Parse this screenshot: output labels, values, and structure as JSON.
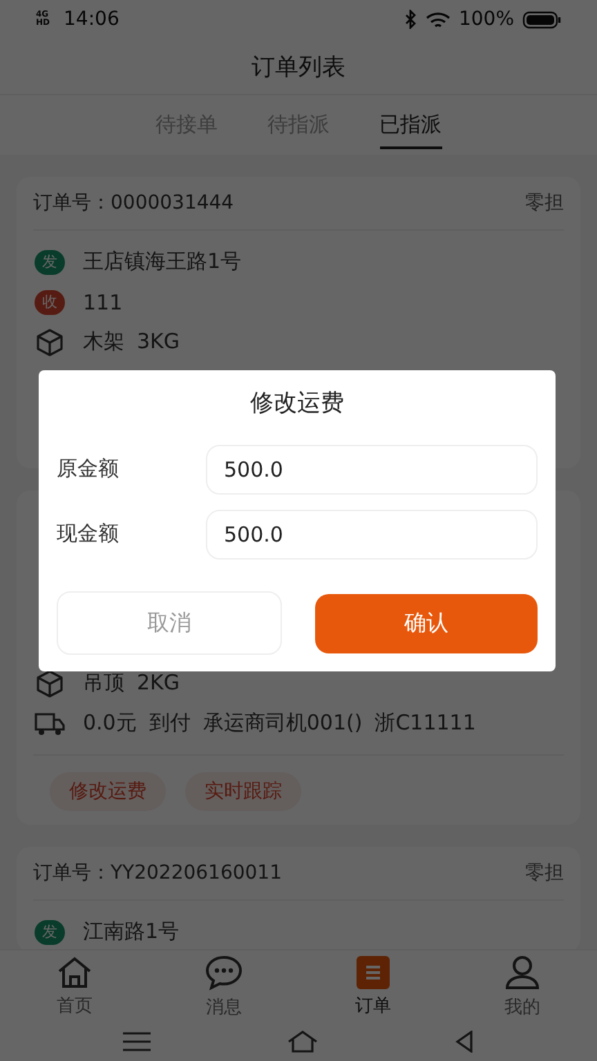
{
  "status_bar": {
    "network": "4G HD",
    "time": "14:06",
    "battery": "100%"
  },
  "header": {
    "title": "订单列表"
  },
  "tabs": [
    {
      "label": "待接单",
      "selected": false
    },
    {
      "label": "待指派",
      "selected": false
    },
    {
      "label": "已指派",
      "selected": true
    }
  ],
  "orders": [
    {
      "number_label": "订单号：",
      "number": "0000031444",
      "type": "零担",
      "rows": [
        {
          "kind": "sender",
          "badge": "发",
          "parts": [
            "王店镇海王路1号"
          ]
        },
        {
          "kind": "receiver",
          "badge": "收",
          "parts": [
            "111"
          ]
        },
        {
          "kind": "cargo",
          "parts": [
            "木架",
            "3KG"
          ]
        }
      ]
    },
    {
      "rows": [
        {
          "kind": "cargo",
          "parts": [
            "吊顶",
            "2KG"
          ]
        },
        {
          "kind": "freight",
          "parts": [
            "0.0元",
            "到付",
            "承运商司机001()",
            "浙C11111"
          ]
        }
      ],
      "actions": [
        "修改运费",
        "实时跟踪"
      ]
    },
    {
      "number_label": "订单号：",
      "number": "YY202206160011",
      "type": "零担",
      "rows": [
        {
          "kind": "sender",
          "badge": "发",
          "parts": [
            "江南路1号"
          ]
        }
      ]
    }
  ],
  "dialog": {
    "title": "修改运费",
    "fields": [
      {
        "label": "原金额",
        "value": "500.0"
      },
      {
        "label": "现金额",
        "value": "500.0"
      }
    ],
    "buttons": [
      {
        "kind": "cancel",
        "label": "取消"
      },
      {
        "kind": "confirm",
        "label": "确认"
      }
    ]
  },
  "bottom_nav": [
    {
      "kind": "home",
      "label": "首页",
      "selected": false
    },
    {
      "kind": "messages",
      "label": "消息",
      "selected": false
    },
    {
      "kind": "orders",
      "label": "订单",
      "selected": true
    },
    {
      "kind": "profile",
      "label": "我的",
      "selected": false
    }
  ]
}
